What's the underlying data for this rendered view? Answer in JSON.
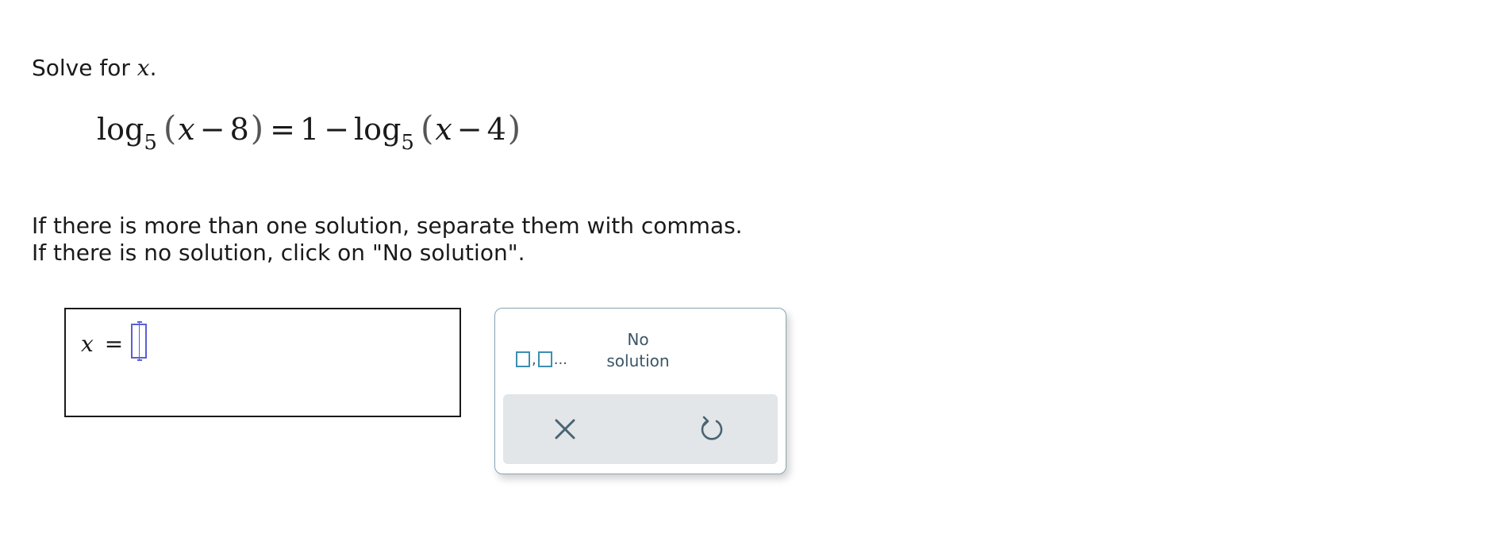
{
  "question": {
    "prompt_text": "Solve for ",
    "prompt_var": "x",
    "prompt_end": ".",
    "equation": {
      "lhs_fn": "log",
      "lhs_base": "5",
      "lhs_arg_var": "x",
      "lhs_arg_op": "−",
      "lhs_arg_num": "8",
      "equals": "=",
      "rhs_const": "1",
      "rhs_op": "−",
      "rhs_fn": "log",
      "rhs_base": "5",
      "rhs_arg_var": "x",
      "rhs_arg_op": "−",
      "rhs_arg_num": "4",
      "open_paren": "(",
      "close_paren": ")"
    },
    "instruction_line1": "If there is more than one solution, separate them with commas.",
    "instruction_line2": "If there is no solution, click on \"No solution\"."
  },
  "answer": {
    "variable": "x",
    "equals": "=",
    "value": ""
  },
  "keypad": {
    "list_key_comma": ",",
    "list_key_dots": "...",
    "no_solution_line1": "No",
    "no_solution_line2": "solution",
    "clear_icon": "close-icon",
    "undo_icon": "undo-icon",
    "icon_color": "#4a6472",
    "border_color": "#8aa3b3",
    "action_bar_color": "#e2e6e9",
    "list_key_color": "#3b8fb0",
    "cursor_color": "#5a5fd6"
  }
}
